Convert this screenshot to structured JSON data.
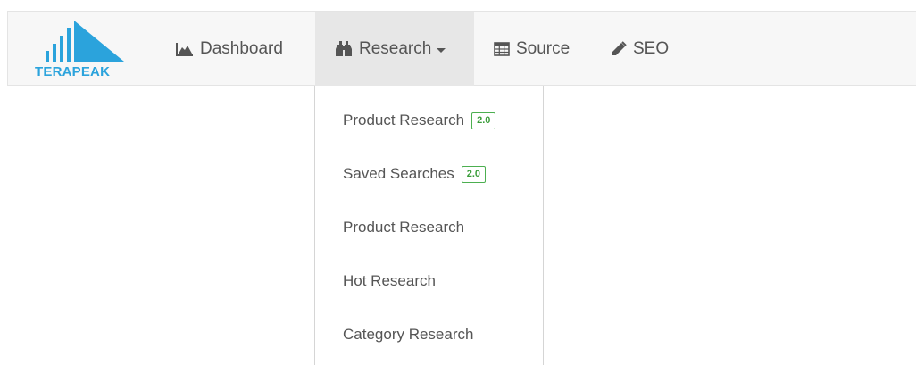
{
  "brand": {
    "logo_text": "TERAPEAK",
    "logo_icon": "bar-peak-icon",
    "color": "#2ba3dc"
  },
  "nav": {
    "dashboard": {
      "label": "Dashboard",
      "icon": "area-chart-icon"
    },
    "research": {
      "label": "Research",
      "icon": "binoculars-icon",
      "open": true
    },
    "source": {
      "label": "Source",
      "icon": "table-icon"
    },
    "seo": {
      "label": "SEO",
      "icon": "pencil-icon"
    }
  },
  "research_menu": {
    "items": [
      {
        "label": "Product Research",
        "badge": "2.0"
      },
      {
        "label": "Saved Searches",
        "badge": "2.0"
      },
      {
        "label": "Product Research"
      },
      {
        "label": "Hot Research"
      },
      {
        "label": "Category Research"
      }
    ]
  },
  "colors": {
    "badge": "#4caf50",
    "nav_active_bg": "#e7e7e7",
    "navbar_bg": "#f7f7f7",
    "text": "#555555"
  }
}
